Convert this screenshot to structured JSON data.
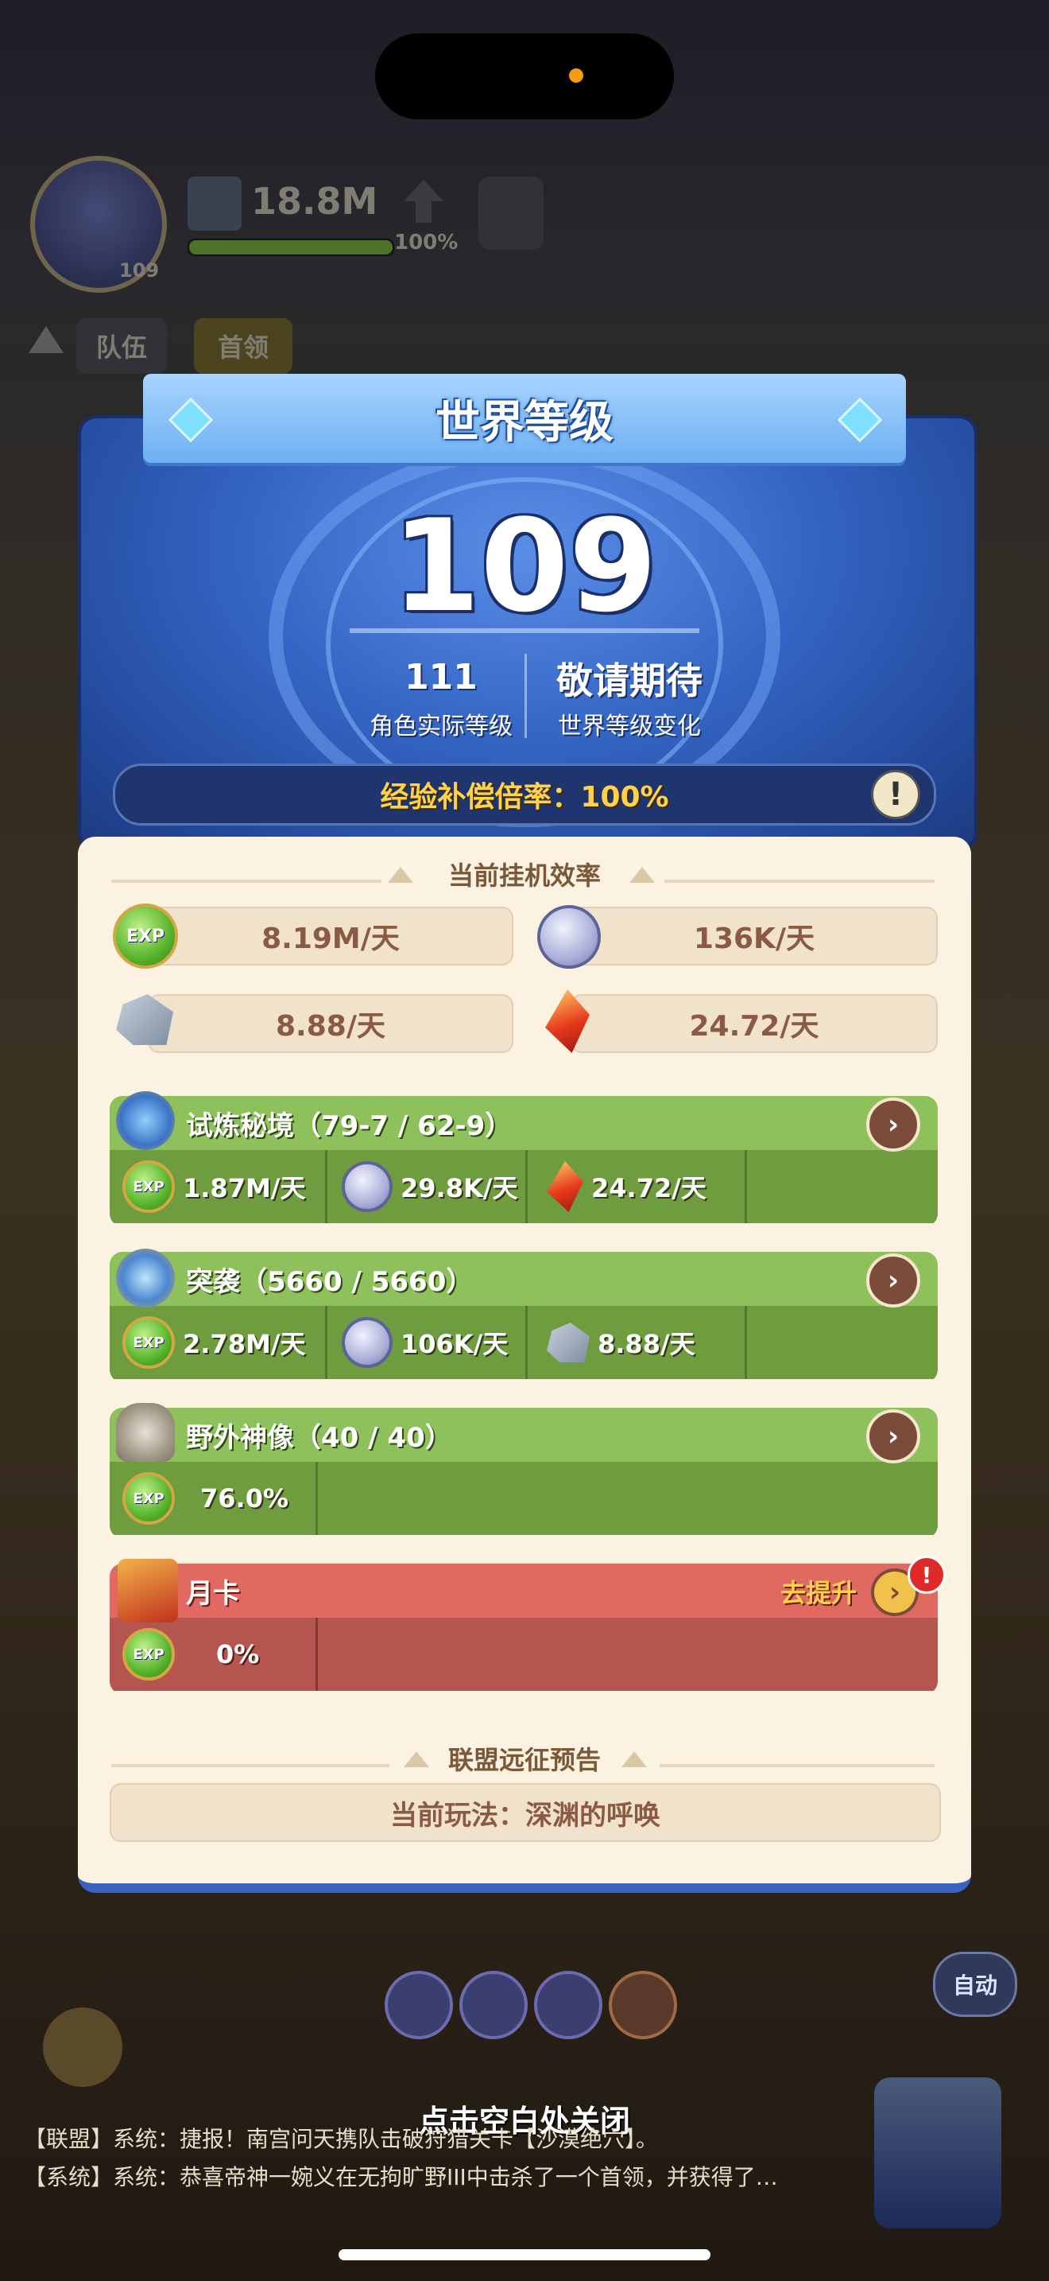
{
  "hud": {
    "power": "18.8M",
    "power_pct": "100%",
    "player_level": "109",
    "tabs": [
      "队伍",
      "首领"
    ]
  },
  "world_level": {
    "title": "世界等级",
    "level": "109",
    "actual_level": "111",
    "actual_label": "角色实际等级",
    "change_value": "敬请期待",
    "change_label": "世界等级变化",
    "exp_rate": "经验补偿倍率：100%",
    "info_icon": "exclamation-icon"
  },
  "idle": {
    "title": "当前挂机效率",
    "items": [
      {
        "icon": "exp-icon",
        "value": "8.19M/天"
      },
      {
        "icon": "coin-icon",
        "value": "136K/天"
      },
      {
        "icon": "stone-icon",
        "value": "8.88/天"
      },
      {
        "icon": "crystal-icon",
        "value": "24.72/天"
      }
    ]
  },
  "groups": [
    {
      "name": "试炼秘境（79-7 / 62-9）",
      "theme": "green",
      "cells": [
        {
          "icon": "exp-icon",
          "value": "1.87M/天"
        },
        {
          "icon": "coin-icon",
          "value": "29.8K/天"
        },
        {
          "icon": "crystal-icon",
          "value": "24.72/天"
        }
      ]
    },
    {
      "name": "突袭（5660 / 5660）",
      "theme": "green",
      "cells": [
        {
          "icon": "exp-icon",
          "value": "2.78M/天"
        },
        {
          "icon": "coin-icon",
          "value": "106K/天"
        },
        {
          "icon": "stone-icon",
          "value": "8.88/天"
        }
      ]
    },
    {
      "name": "野外神像（40 / 40）",
      "theme": "green",
      "cells": [
        {
          "icon": "exp-icon",
          "value": "76.0%"
        }
      ]
    },
    {
      "name": "月卡",
      "theme": "red",
      "action": "去提升",
      "cells": [
        {
          "icon": "exp-icon",
          "value": "0%"
        }
      ]
    }
  ],
  "forecast": {
    "title": "联盟远征预告",
    "current": "当前玩法：深渊的呼唤"
  },
  "close_hint": "点击空白处关闭",
  "chat": [
    "【联盟】系统：捷报！南宫问天携队击破狩猎关卡【沙漠绝穴】。",
    "【系统】系统：恭喜帝神一婉义在无拘旷野III中击杀了一个首领，并获得了…"
  ],
  "auto_label": "自动",
  "colors": {
    "panel_blue": "#3465c4",
    "cream": "#fbf2e2",
    "green_head": "#8ec15c",
    "green_body": "#6e9c3e",
    "red_head": "#e06a62",
    "gold_text": "#ffd24a"
  }
}
